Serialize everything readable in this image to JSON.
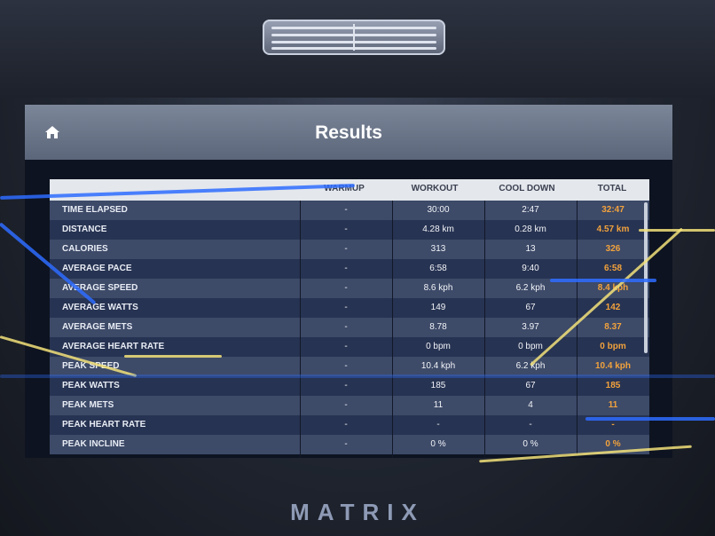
{
  "device": {
    "brand": "MATRIX"
  },
  "header": {
    "title": "Results",
    "home_icon": "home-icon"
  },
  "columns": [
    "WARMUP",
    "WORKOUT",
    "COOL DOWN",
    "TOTAL"
  ],
  "rows": [
    {
      "label": "TIME ELAPSED",
      "warmup": "-",
      "workout": "30:00",
      "cooldown": "2:47",
      "total": "32:47"
    },
    {
      "label": "DISTANCE",
      "warmup": "-",
      "workout": "4.28 km",
      "cooldown": "0.28 km",
      "total": "4.57 km"
    },
    {
      "label": "CALORIES",
      "warmup": "-",
      "workout": "313",
      "cooldown": "13",
      "total": "326"
    },
    {
      "label": "AVERAGE PACE",
      "warmup": "-",
      "workout": "6:58",
      "cooldown": "9:40",
      "total": "6:58"
    },
    {
      "label": "AVERAGE SPEED",
      "warmup": "-",
      "workout": "8.6 kph",
      "cooldown": "6.2 kph",
      "total": "8.4 kph"
    },
    {
      "label": "AVERAGE WATTS",
      "warmup": "-",
      "workout": "149",
      "cooldown": "67",
      "total": "142"
    },
    {
      "label": "AVERAGE METS",
      "warmup": "-",
      "workout": "8.78",
      "cooldown": "3.97",
      "total": "8.37"
    },
    {
      "label": "AVERAGE HEART RATE",
      "warmup": "-",
      "workout": "0 bpm",
      "cooldown": "0 bpm",
      "total": "0 bpm"
    },
    {
      "label": "PEAK SPEED",
      "warmup": "-",
      "workout": "10.4 kph",
      "cooldown": "6.2 kph",
      "total": "10.4 kph"
    },
    {
      "label": "PEAK WATTS",
      "warmup": "-",
      "workout": "185",
      "cooldown": "67",
      "total": "185"
    },
    {
      "label": "PEAK METS",
      "warmup": "-",
      "workout": "11",
      "cooldown": "4",
      "total": "11"
    },
    {
      "label": "PEAK HEART RATE",
      "warmup": "-",
      "workout": "-",
      "cooldown": "-",
      "total": "-"
    },
    {
      "label": "PEAK INCLINE",
      "warmup": "-",
      "workout": "0 %",
      "cooldown": "0 %",
      "total": "0 %"
    }
  ],
  "colors": {
    "total_accent": "#f2a23c",
    "header_bg": "#6b7589"
  }
}
